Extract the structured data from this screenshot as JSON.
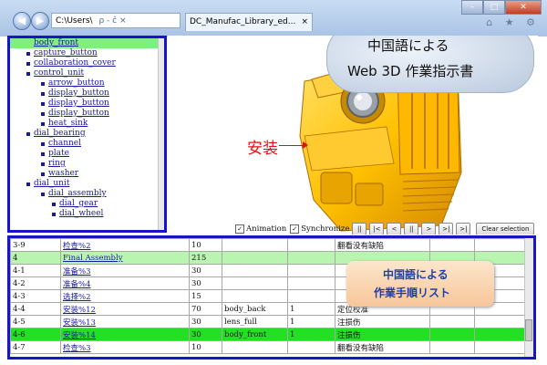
{
  "browser": {
    "address": "C:\\Users\\",
    "address_controls": "ρ - č ×",
    "tab_title": "DC_Manufac_Library_ed...",
    "tab_close": "×",
    "window_buttons": {
      "minimize": "–",
      "maximize": "□",
      "close": "✕"
    },
    "toolbar_icons": "⌂ ★ ⚙"
  },
  "tree": {
    "items": [
      {
        "label": "body_front",
        "level": 1,
        "selected": true
      },
      {
        "label": "capture_button",
        "level": 1
      },
      {
        "label": "collaboration_cover",
        "level": 1
      },
      {
        "label": "control_unit",
        "level": 1
      },
      {
        "label": "arrow_button",
        "level": 2
      },
      {
        "label": "display_button",
        "level": 2
      },
      {
        "label": "display_button",
        "level": 2
      },
      {
        "label": "display_button",
        "level": 2
      },
      {
        "label": "heat_sink",
        "level": 2
      },
      {
        "label": "dial_bearing",
        "level": 1
      },
      {
        "label": "channel",
        "level": 2
      },
      {
        "label": "plate",
        "level": 2
      },
      {
        "label": "ring",
        "level": 2
      },
      {
        "label": "washer",
        "level": 2
      },
      {
        "label": "dial_unit",
        "level": 1
      },
      {
        "label": "dial_assembly",
        "level": 2
      },
      {
        "label": "dial_gear",
        "level": 3
      },
      {
        "label": "dial_wheel",
        "level": 3
      }
    ]
  },
  "viewer": {
    "callout_line1": "中国語による",
    "callout_line2": "Web 3D 作業指示書",
    "annotation": "安装",
    "model_color": "#ffc000",
    "animation_label": "Animation",
    "synchronize_label": "Synchronize",
    "animation_checked": true,
    "synchronize_checked": true,
    "playback_buttons": [
      "||",
      "|<",
      "<",
      "||",
      ">",
      ">|",
      ">|"
    ],
    "clear_selection": "Clear selection"
  },
  "steps": {
    "rows": [
      {
        "no": "3-9",
        "name": "检查%2",
        "time": "10",
        "part": "",
        "qty": "",
        "note": "翻看没有缺陷",
        "link": true,
        "style": ""
      },
      {
        "no": "4",
        "name": "Final Assembly",
        "time": "215",
        "part": "",
        "qty": "",
        "note": "",
        "link": true,
        "style": "lightgreen"
      },
      {
        "no": "4-1",
        "name": "准备%3",
        "time": "30",
        "part": "",
        "qty": "",
        "note": "",
        "link": true,
        "style": ""
      },
      {
        "no": "4-2",
        "name": "准备%4",
        "time": "30",
        "part": "",
        "qty": "",
        "note": "",
        "link": true,
        "style": ""
      },
      {
        "no": "4-3",
        "name": "选择%2",
        "time": "15",
        "part": "",
        "qty": "",
        "note": "",
        "link": true,
        "style": ""
      },
      {
        "no": "4-4",
        "name": "安装%12",
        "time": "70",
        "part": "body_back",
        "qty": "1",
        "note": "定位校准",
        "link": true,
        "style": ""
      },
      {
        "no": "4-5",
        "name": "安装%13",
        "time": "30",
        "part": "lens_full",
        "qty": "1",
        "note": "注损伤",
        "link": true,
        "style": ""
      },
      {
        "no": "4-6",
        "name": "安装%14",
        "time": "30",
        "part": "body_front",
        "qty": "1",
        "note": "注损伤",
        "link": true,
        "style": "green"
      },
      {
        "no": "4-7",
        "name": "检查%3",
        "time": "10",
        "part": "",
        "qty": "",
        "note": "翻看没有缺陷",
        "link": true,
        "style": ""
      }
    ],
    "callout_line1": "中国語による",
    "callout_line2": "作業手順リスト"
  }
}
